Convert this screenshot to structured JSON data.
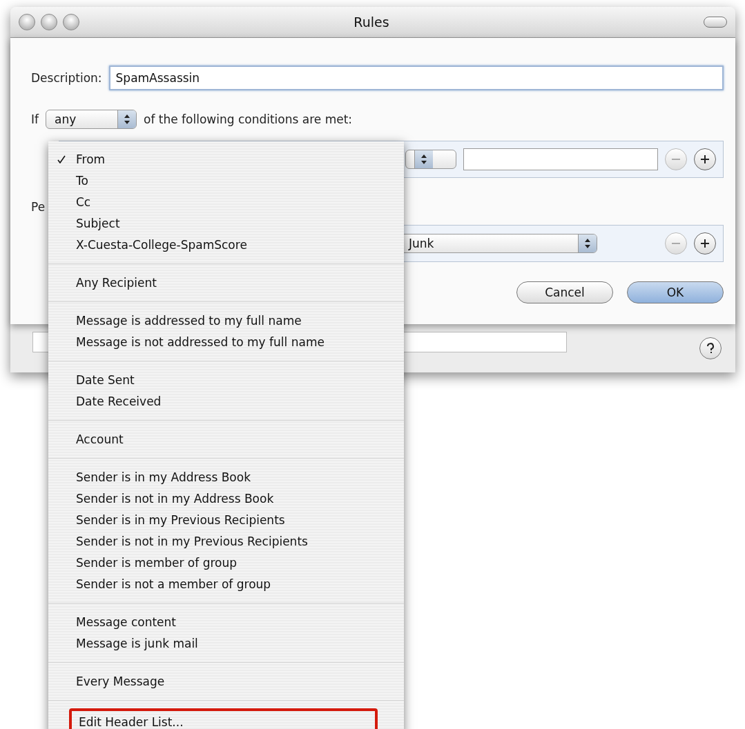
{
  "window": {
    "title": "Rules"
  },
  "sheet": {
    "description_label": "Description:",
    "description_value": "SpamAssassin",
    "if_label": "If",
    "match_popup": "any",
    "match_suffix": "of the following conditions are met:",
    "actions_label": "Pe",
    "mailbox_popup": "Junk",
    "buttons": [
      {
        "label": "Cancel",
        "default": false
      },
      {
        "label": "OK",
        "default": true
      }
    ]
  },
  "menu": {
    "sections": [
      {
        "items": [
          {
            "label": "From",
            "checked": true,
            "annotated": false
          },
          {
            "label": "To",
            "checked": false,
            "annotated": false
          },
          {
            "label": "Cc",
            "checked": false,
            "annotated": false
          },
          {
            "label": "Subject",
            "checked": false,
            "annotated": false
          },
          {
            "label": "X-Cuesta-College-SpamScore",
            "checked": false,
            "annotated": false
          }
        ]
      },
      {
        "items": [
          {
            "label": "Any Recipient",
            "checked": false,
            "annotated": false
          }
        ]
      },
      {
        "items": [
          {
            "label": "Message is addressed to my full name",
            "checked": false,
            "annotated": false
          },
          {
            "label": "Message is not addressed to my full name",
            "checked": false,
            "annotated": false
          }
        ]
      },
      {
        "items": [
          {
            "label": "Date Sent",
            "checked": false,
            "annotated": false
          },
          {
            "label": "Date Received",
            "checked": false,
            "annotated": false
          }
        ]
      },
      {
        "items": [
          {
            "label": "Account",
            "checked": false,
            "annotated": false
          }
        ]
      },
      {
        "items": [
          {
            "label": "Sender is in my Address Book",
            "checked": false,
            "annotated": false
          },
          {
            "label": "Sender is not in my Address Book",
            "checked": false,
            "annotated": false
          },
          {
            "label": "Sender is in my Previous Recipients",
            "checked": false,
            "annotated": false
          },
          {
            "label": "Sender is not in my Previous Recipients",
            "checked": false,
            "annotated": false
          },
          {
            "label": "Sender is member of group",
            "checked": false,
            "annotated": false
          },
          {
            "label": "Sender is not a member of group",
            "checked": false,
            "annotated": false
          }
        ]
      },
      {
        "items": [
          {
            "label": "Message content",
            "checked": false,
            "annotated": false
          },
          {
            "label": "Message is junk mail",
            "checked": false,
            "annotated": false
          }
        ]
      },
      {
        "items": [
          {
            "label": "Every Message",
            "checked": false,
            "annotated": false
          }
        ]
      },
      {
        "items": [
          {
            "label": "Edit Header List...",
            "checked": false,
            "annotated": true
          }
        ]
      }
    ]
  }
}
